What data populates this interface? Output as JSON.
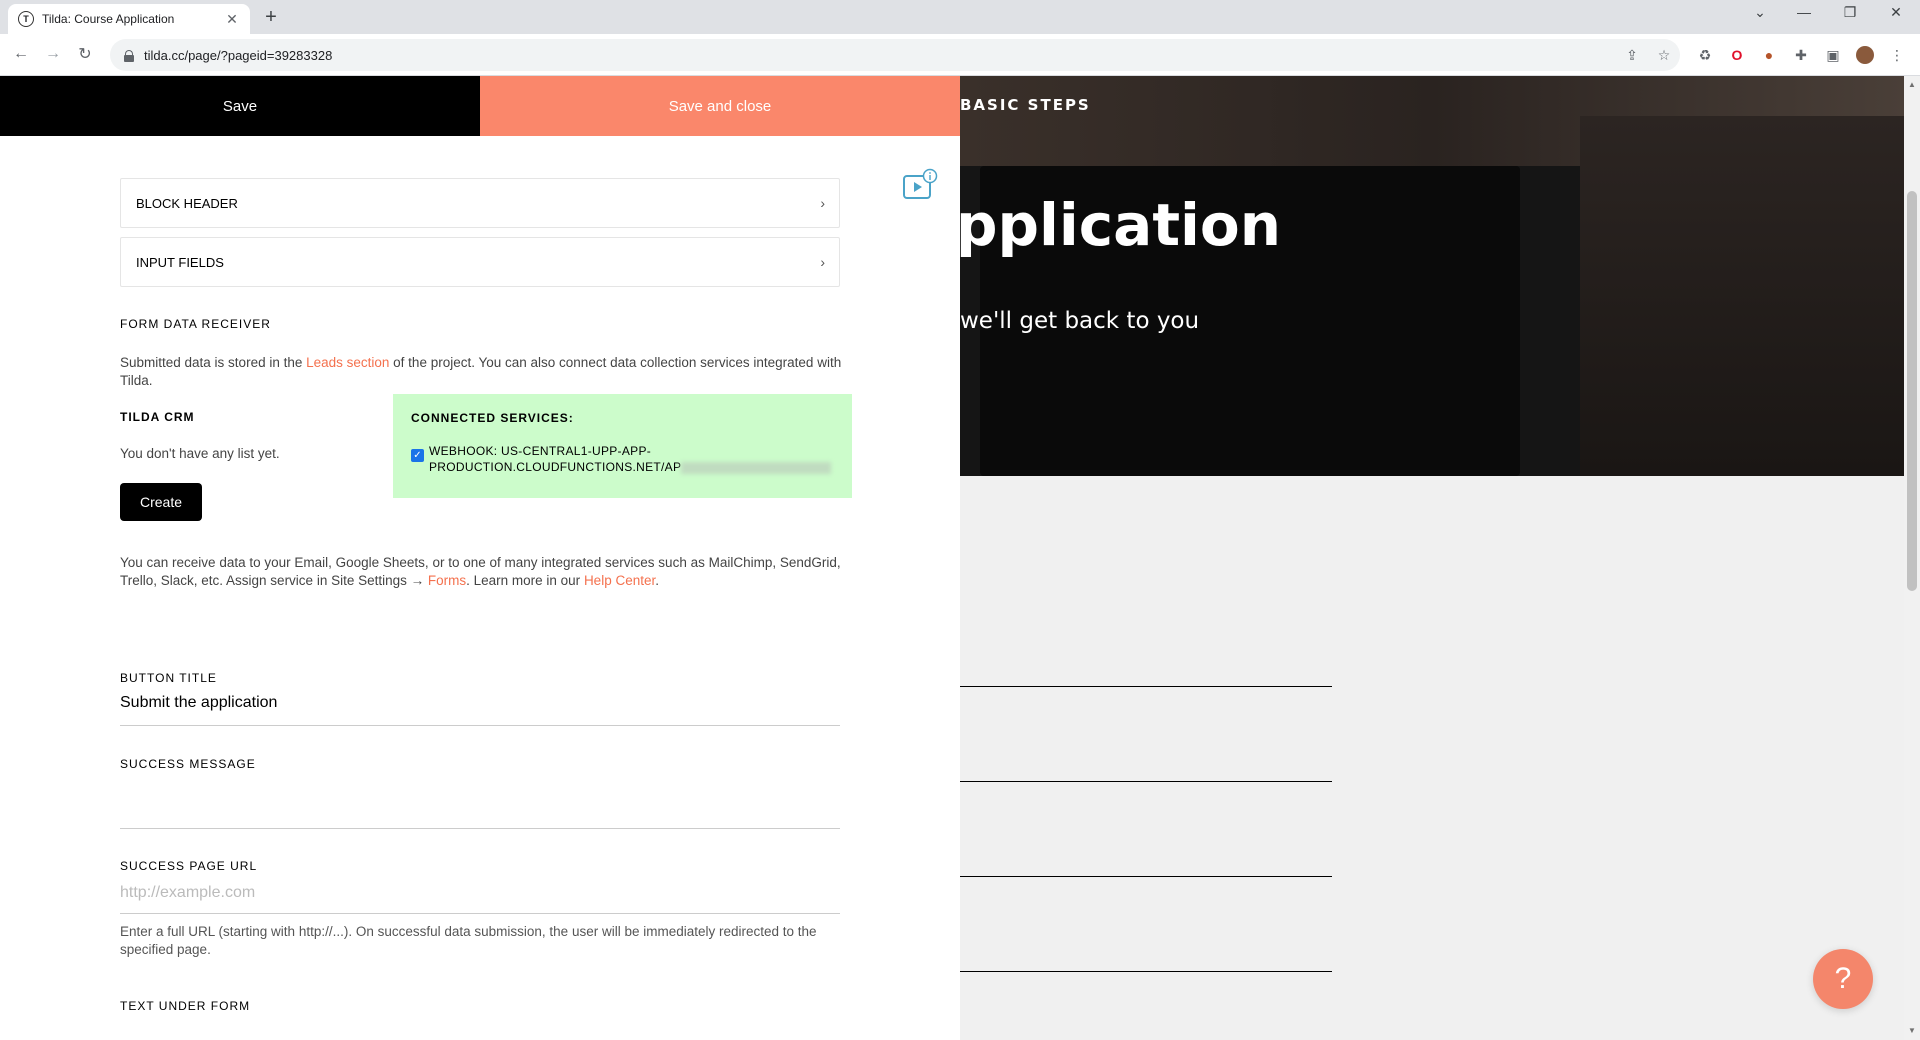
{
  "browser": {
    "tab_title": "Tilda: Course Application",
    "tab_favicon": "T",
    "url": "tilda.cc/page/?pageid=39283328"
  },
  "editor": {
    "save_label": "Save",
    "save_close_label": "Save and close",
    "accordions": [
      {
        "label": "BLOCK HEADER"
      },
      {
        "label": "INPUT FIELDS"
      }
    ],
    "form_receiver": {
      "title": "FORM DATA RECEIVER",
      "desc_prefix": "Submitted data is stored in the ",
      "desc_link": "Leads section",
      "desc_suffix": " of the project. You can also connect data collection services integrated with Tilda."
    },
    "crm": {
      "title": "TILDA CRM",
      "empty_text": "You don't have any list yet.",
      "create_label": "Create"
    },
    "services": {
      "title": "CONNECTED SERVICES:",
      "webhook_line1": "WEBHOOK: US-CENTRAL1-UPP-APP-",
      "webhook_line2": "PRODUCTION.CLOUDFUNCTIONS.NET/AP",
      "checked": true
    },
    "integrations": {
      "text_prefix": "You can receive data to your Email, Google Sheets, or to one of many integrated services such as MailChimp, SendGrid, Trello, Slack, etc. Assign service in Site Settings → ",
      "forms_link": "Forms",
      "text_middle": ". Learn more in our ",
      "help_link": "Help Center",
      "text_end": "."
    },
    "button_title": {
      "label": "BUTTON TITLE",
      "value": "Submit the application"
    },
    "success_message": {
      "label": "SUCCESS MESSAGE",
      "value": ""
    },
    "success_url": {
      "label": "SUCCESS PAGE URL",
      "placeholder": "http://example.com",
      "hint": "Enter a full URL (starting with http://...). On successful data submission, the user will be immediately redirected to the specified page."
    },
    "text_under_form": {
      "label": "TEXT UNDER FORM"
    }
  },
  "preview": {
    "label": "BASIC STEPS",
    "title": "pplication",
    "subtitle": "we'll get back to you",
    "help_symbol": "?"
  }
}
